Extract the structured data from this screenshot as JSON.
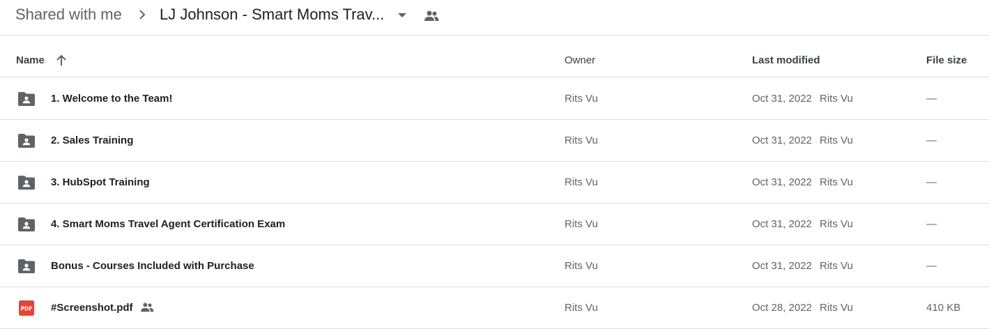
{
  "breadcrumb": {
    "root": "Shared with me",
    "current": "LJ Johnson - Smart Moms Trav..."
  },
  "columns": {
    "name": "Name",
    "owner": "Owner",
    "last_modified": "Last modified",
    "file_size": "File size"
  },
  "rows": [
    {
      "name": "1. Welcome to the Team!",
      "type": "shared-folder",
      "owner": "Rits Vu",
      "date": "Oct 31, 2022",
      "modified_by": "Rits Vu",
      "size": "—"
    },
    {
      "name": "2. Sales Training",
      "type": "shared-folder",
      "owner": "Rits Vu",
      "date": "Oct 31, 2022",
      "modified_by": "Rits Vu",
      "size": "—"
    },
    {
      "name": "3. HubSpot Training",
      "type": "shared-folder",
      "owner": "Rits Vu",
      "date": "Oct 31, 2022",
      "modified_by": "Rits Vu",
      "size": "—"
    },
    {
      "name": "4. Smart Moms Travel Agent Certification Exam",
      "type": "shared-folder",
      "owner": "Rits Vu",
      "date": "Oct 31, 2022",
      "modified_by": "Rits Vu",
      "size": "—"
    },
    {
      "name": "Bonus - Courses Included with Purchase",
      "type": "shared-folder",
      "owner": "Rits Vu",
      "date": "Oct 31, 2022",
      "modified_by": "Rits Vu",
      "size": "—"
    },
    {
      "name": "#Screenshot.pdf",
      "type": "pdf",
      "icon_label": "PDF",
      "shared": true,
      "owner": "Rits Vu",
      "date": "Oct 28, 2022",
      "modified_by": "Rits Vu",
      "size": "410 KB"
    }
  ],
  "colors": {
    "folder_icon": "#5f6368",
    "pdf_icon": "#ea4335",
    "divider": "#dadce0",
    "secondary_text": "#5f6368"
  }
}
